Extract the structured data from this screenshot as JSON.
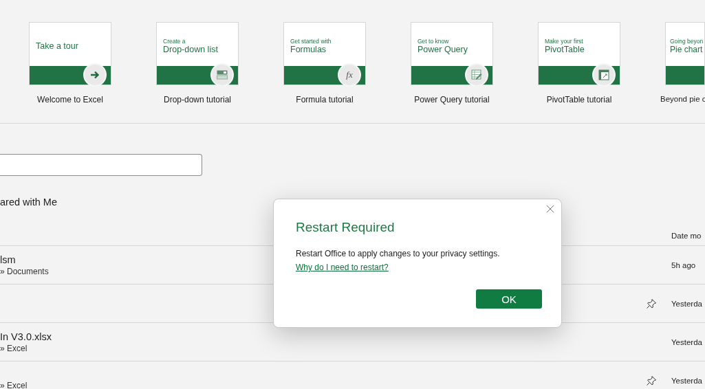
{
  "templates": [
    {
      "heading": "Take a tour",
      "caption": "Welcome to Excel",
      "kind": "arrow"
    },
    {
      "kicker": "Create a",
      "heading": "Drop-down list",
      "caption": "Drop-down tutorial",
      "kind": "form"
    },
    {
      "kicker": "Get started with",
      "heading": "Formulas",
      "caption": "Formula tutorial",
      "kind": "function",
      "icon_text": "fx"
    },
    {
      "kicker": "Get to know",
      "heading": "Power Query",
      "caption": "Power Query tutorial",
      "kind": "table"
    },
    {
      "kicker": "Make your first",
      "heading": "PivotTable",
      "caption": "PivotTable tutorial",
      "kind": "pivot"
    },
    {
      "kicker": "Going beyon",
      "heading": "Pie chart",
      "caption": "Beyond pie c",
      "kind": "cut"
    }
  ],
  "section_title": "ared with Me",
  "columns": [
    {
      "label": "Date mo"
    }
  ],
  "files": [
    {
      "name": "lsm",
      "location": "» Documents",
      "pinned": false,
      "date": "5h ago"
    },
    {
      "pinned": true,
      "date": "Yesterda"
    },
    {
      "name": "In V3.0.xlsx",
      "location": "» Excel",
      "pinned": false,
      "date": "Yesterda"
    },
    {
      "location": "» Excel",
      "pinned": true,
      "date": "Yesterda"
    }
  ],
  "dialog": {
    "title": "Restart Required",
    "message": "Restart Office to apply changes to your privacy settings.",
    "link": "Why do I need to restart?",
    "button": "OK"
  }
}
